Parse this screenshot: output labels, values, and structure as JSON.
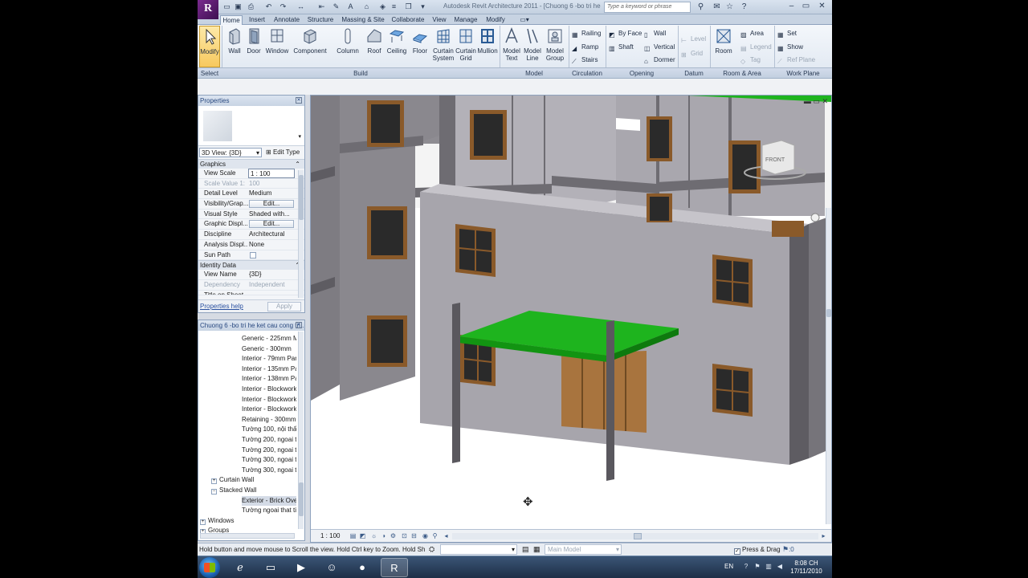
{
  "window": {
    "app_logo": "R",
    "title": "Autodesk Revit Architecture 2011 - [Chuong 6 -bo tri he",
    "search_placeholder": "Type a keyword or phrase"
  },
  "tabs": [
    "Home",
    "Insert",
    "Annotate",
    "Structure",
    "Massing & Site",
    "Collaborate",
    "View",
    "Manage",
    "Modify"
  ],
  "active_tab": "Home",
  "ribbon": {
    "modify": "Modify",
    "build": [
      {
        "label": "Wall",
        "icon": "wall-icon"
      },
      {
        "label": "Door",
        "icon": "door-icon"
      },
      {
        "label": "Window",
        "icon": "window-icon"
      },
      {
        "label": "Component",
        "icon": "component-icon"
      },
      {
        "label": "Column",
        "icon": "column-icon"
      },
      {
        "label": "Roof",
        "icon": "roof-icon"
      },
      {
        "label": "Ceiling",
        "icon": "ceiling-icon"
      },
      {
        "label": "Floor",
        "icon": "floor-icon"
      },
      {
        "label": "Curtain\nSystem",
        "icon": "curtain-system-icon"
      },
      {
        "label": "Curtain\nGrid",
        "icon": "curtain-grid-icon"
      },
      {
        "label": "Mullion",
        "icon": "mullion-icon"
      }
    ],
    "model": [
      {
        "label": "Model\nText",
        "icon": "model-text-icon"
      },
      {
        "label": "Model\nLine",
        "icon": "model-line-icon"
      },
      {
        "label": "Model\nGroup",
        "icon": "model-group-icon"
      }
    ],
    "circulation": [
      "Railing",
      "Ramp",
      "Stairs"
    ],
    "opening": [
      "By Face",
      "Shaft",
      "Wall",
      "Vertical",
      "Dormer"
    ],
    "datum": [
      "Level",
      "Grid"
    ],
    "room_area": {
      "room": "Room",
      "items": [
        "Area",
        "Legend",
        "Tag"
      ]
    },
    "work_plane": [
      "Set",
      "Show",
      "Ref Plane"
    ],
    "panels": [
      "Select",
      "Build",
      "Model",
      "Circulation",
      "Opening",
      "Datum",
      "Room & Area",
      "Work Plane"
    ]
  },
  "properties": {
    "title": "Properties",
    "type_selector": "3D View: {3D}",
    "edit_type": "Edit Type",
    "sections": {
      "graphics": "Graphics",
      "identity": "Identity Data"
    },
    "graphics_rows": [
      {
        "key": "View Scale",
        "value": "1 : 100"
      },
      {
        "key": "Scale Value    1:",
        "value": "100"
      },
      {
        "key": "Detail Level",
        "value": "Medium"
      },
      {
        "key": "Visibility/Grap...",
        "value": "Edit..."
      },
      {
        "key": "Visual Style",
        "value": "Shaded with..."
      },
      {
        "key": "Graphic Displ...",
        "value": "Edit..."
      },
      {
        "key": "Discipline",
        "value": "Architectural"
      },
      {
        "key": "Analysis Displ...",
        "value": "None"
      },
      {
        "key": "Sun Path",
        "value": ""
      }
    ],
    "identity_rows": [
      {
        "key": "View Name",
        "value": "{3D}"
      },
      {
        "key": "Dependency",
        "value": "Independent"
      },
      {
        "key": "Title on Sheet",
        "value": ""
      }
    ],
    "help_link": "Properties help",
    "apply": "Apply"
  },
  "browser": {
    "title": "Chuong 6 -bo tri he ket cau cong tri...",
    "items": [
      "Generic - 225mm Ma",
      "Generic - 300mm",
      "Interior - 79mm Part",
      "Interior - 135mm Par",
      "Interior - 138mm Par",
      "Interior - Blockwork",
      "Interior - Blockwork",
      "Interior - Blockwork",
      "Retaining - 300mm C",
      "Tường 100, nội thất",
      "Tường 200, ngoai th",
      "Tường 200, ngoai th",
      "Tường 300, ngoai th",
      "Tường 300, ngoai th",
      "Curtain Wall",
      "Stacked Wall",
      "Exterior - Brick Over",
      "Tường ngoai that tie",
      "Windows",
      "Groups"
    ]
  },
  "viewport": {
    "viewcube": "FRONT",
    "scale": "1 : 100",
    "colors": {
      "wall": "#a7a5ac",
      "canopy": "#1eb41e",
      "window_frame": "#8a5a2a",
      "door": "#a8743e"
    }
  },
  "status": {
    "message": "Hold button and move mouse to Scroll the view. Hold Ctrl key to Zoom. Hold Shift key",
    "model": "Main Model",
    "press_drag": "Press & Drag",
    "filter_count": ":0"
  },
  "taskbar": {
    "lang": "EN",
    "time": "8:08 CH",
    "date": "17/11/2010"
  }
}
